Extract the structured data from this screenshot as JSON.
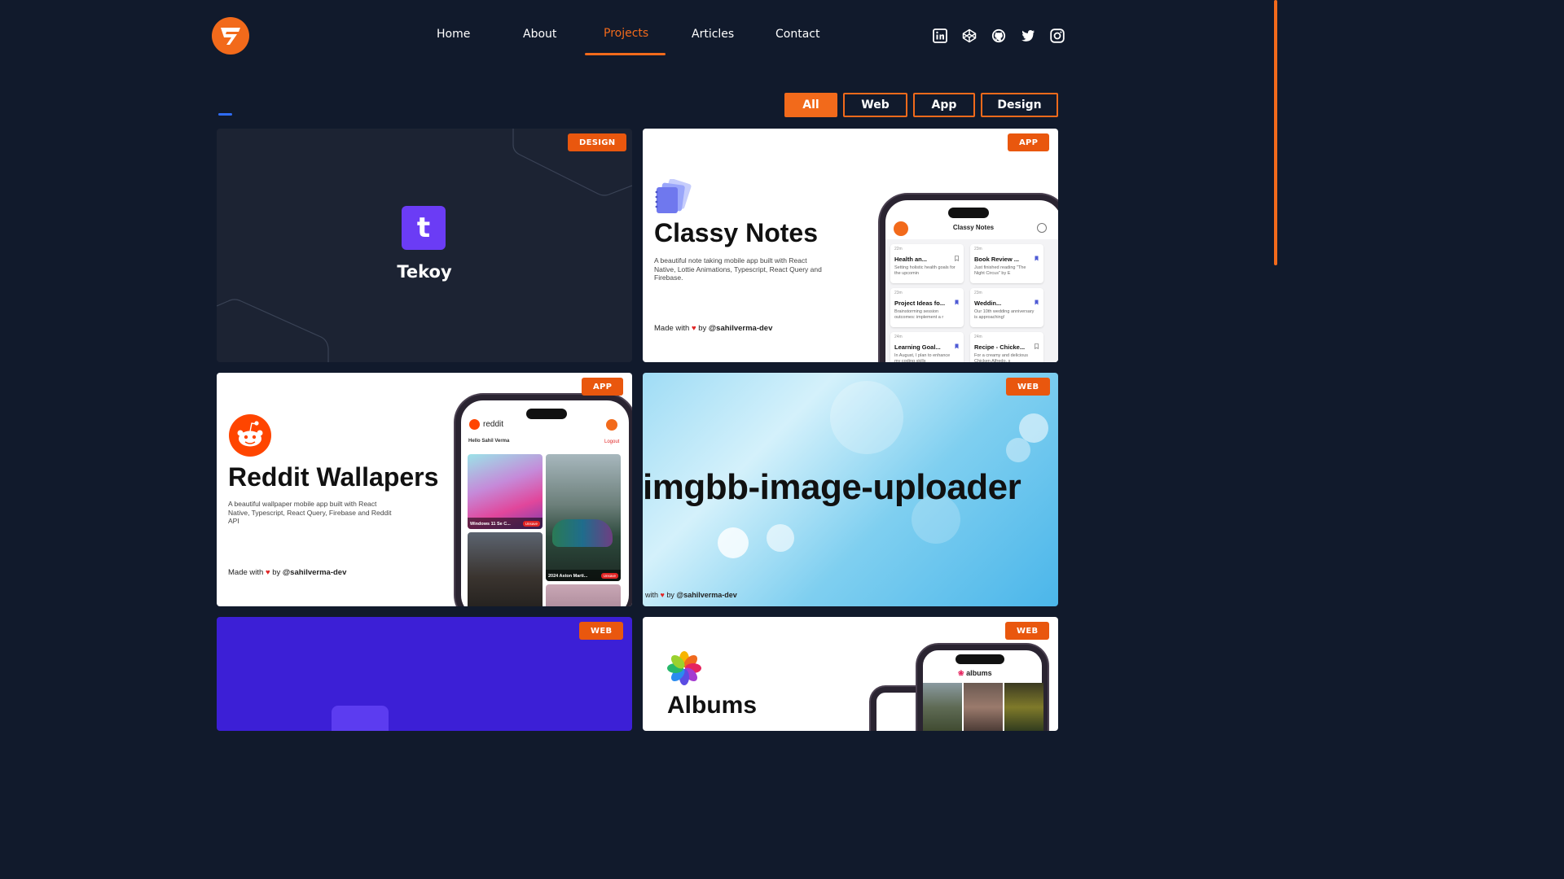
{
  "nav": {
    "items": [
      {
        "label": "Home"
      },
      {
        "label": "About"
      },
      {
        "label": "Projects"
      },
      {
        "label": "Articles"
      },
      {
        "label": "Contact"
      }
    ],
    "active": "Projects"
  },
  "social": [
    "linkedin-icon",
    "codepen-icon",
    "github-icon",
    "twitter-icon",
    "instagram-icon"
  ],
  "filters": [
    {
      "label": "All",
      "active": true
    },
    {
      "label": "Web",
      "active": false
    },
    {
      "label": "App",
      "active": false
    },
    {
      "label": "Design",
      "active": false
    }
  ],
  "colors": {
    "background": "#111a2c",
    "accent": "#f26a1b",
    "badge": "#e9570e"
  },
  "projects": {
    "tekoy": {
      "badge": "DESIGN",
      "name": "Tekoy",
      "icon_letter": "t"
    },
    "classy_notes": {
      "badge": "APP",
      "title": "Classy Notes",
      "description": "A beautiful note taking mobile app built with React Native, Lottie Animations, Typescript, React Query and Firebase.",
      "made_with": "Made with",
      "by": "by",
      "handle": "@sahilverma-dev",
      "phone_title": "Classy Notes",
      "notes": [
        {
          "date": "22m",
          "title": "Health an...",
          "body": "Setting holistic health goals for the upcomin"
        },
        {
          "date": "23m",
          "title": "Book Review ...",
          "body": "Just finished reading \"The Night Circus\" by E"
        },
        {
          "date": "23m",
          "title": "Project Ideas fo...",
          "body": "Brainstorming session outcomes: implement a r"
        },
        {
          "date": "23m",
          "title": "Weddin...",
          "body": "Our 10th wedding anniversary is approaching!"
        },
        {
          "date": "24m",
          "title": "Learning Goal...",
          "body": "In August, I plan to enhance my coding skills"
        },
        {
          "date": "24m",
          "title": "Recipe - Chicke...",
          "body": "For a creamy and delicious Chicken Alfredo, s"
        }
      ]
    },
    "reddit": {
      "badge": "APP",
      "title": "Reddit Wallapers",
      "description": "A beautiful wallpaper mobile app built with React Native, Typescript, React Query, Firebase and Reddit API",
      "made_with": "Made with",
      "by": "by",
      "handle": "@sahilverma-dev",
      "phone_brand": "reddit",
      "greeting": "Hello Sahil Verma",
      "logout": "Logout",
      "tiles": [
        {
          "caption": "Windows 11 Se C...",
          "action": "Unsave"
        },
        {
          "caption": "2024 Aston Marti...",
          "action": "Unsave"
        }
      ]
    },
    "imgbb": {
      "badge": "WEB",
      "title": "imgbb-image-uploader",
      "made_with": "with",
      "by": "by",
      "handle": "@sahilverma-dev"
    },
    "purple": {
      "badge": "WEB"
    },
    "albums": {
      "badge": "WEB",
      "title": "Albums",
      "phone_brand": "albums"
    }
  }
}
